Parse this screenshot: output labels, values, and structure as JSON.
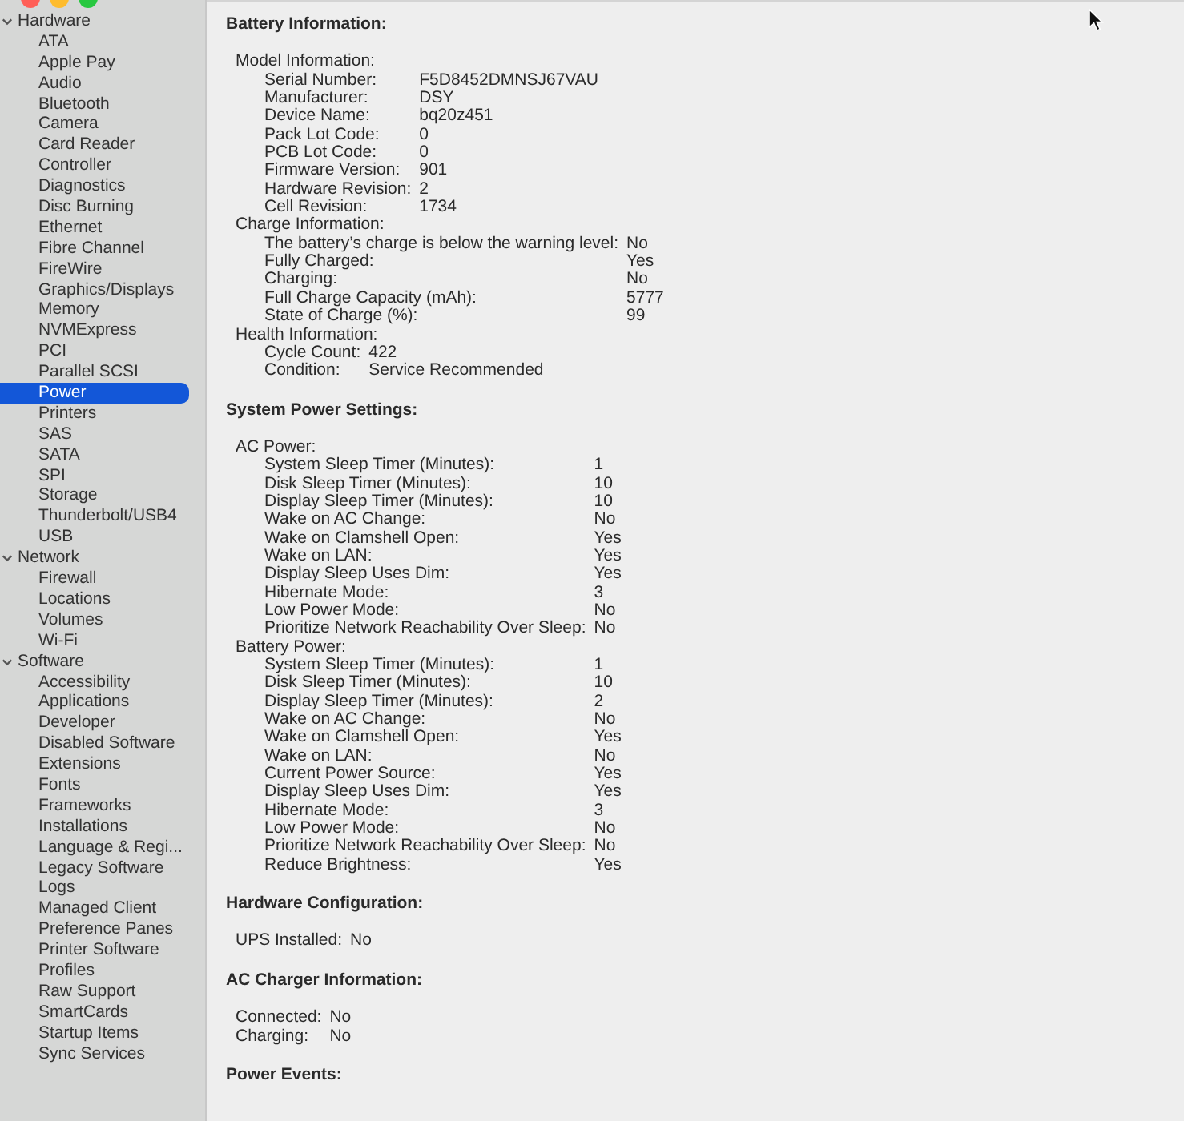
{
  "sidebar": {
    "groups": [
      {
        "label": "Hardware",
        "expanded": true,
        "items": [
          {
            "label": "ATA",
            "selected": false
          },
          {
            "label": "Apple Pay",
            "selected": false
          },
          {
            "label": "Audio",
            "selected": false
          },
          {
            "label": "Bluetooth",
            "selected": false
          },
          {
            "label": "Camera",
            "selected": false
          },
          {
            "label": "Card Reader",
            "selected": false
          },
          {
            "label": "Controller",
            "selected": false
          },
          {
            "label": "Diagnostics",
            "selected": false
          },
          {
            "label": "Disc Burning",
            "selected": false
          },
          {
            "label": "Ethernet",
            "selected": false
          },
          {
            "label": "Fibre Channel",
            "selected": false
          },
          {
            "label": "FireWire",
            "selected": false
          },
          {
            "label": "Graphics/Displays",
            "selected": false
          },
          {
            "label": "Memory",
            "selected": false
          },
          {
            "label": "NVMExpress",
            "selected": false
          },
          {
            "label": "PCI",
            "selected": false
          },
          {
            "label": "Parallel SCSI",
            "selected": false
          },
          {
            "label": "Power",
            "selected": true
          },
          {
            "label": "Printers",
            "selected": false
          },
          {
            "label": "SAS",
            "selected": false
          },
          {
            "label": "SATA",
            "selected": false
          },
          {
            "label": "SPI",
            "selected": false
          },
          {
            "label": "Storage",
            "selected": false
          },
          {
            "label": "Thunderbolt/USB4",
            "selected": false
          },
          {
            "label": "USB",
            "selected": false
          }
        ]
      },
      {
        "label": "Network",
        "expanded": true,
        "items": [
          {
            "label": "Firewall",
            "selected": false
          },
          {
            "label": "Locations",
            "selected": false
          },
          {
            "label": "Volumes",
            "selected": false
          },
          {
            "label": "Wi-Fi",
            "selected": false
          }
        ]
      },
      {
        "label": "Software",
        "expanded": true,
        "items": [
          {
            "label": "Accessibility",
            "selected": false
          },
          {
            "label": "Applications",
            "selected": false
          },
          {
            "label": "Developer",
            "selected": false
          },
          {
            "label": "Disabled Software",
            "selected": false
          },
          {
            "label": "Extensions",
            "selected": false
          },
          {
            "label": "Fonts",
            "selected": false
          },
          {
            "label": "Frameworks",
            "selected": false
          },
          {
            "label": "Installations",
            "selected": false
          },
          {
            "label": "Language & Regi...",
            "selected": false
          },
          {
            "label": "Legacy Software",
            "selected": false
          },
          {
            "label": "Logs",
            "selected": false
          },
          {
            "label": "Managed Client",
            "selected": false
          },
          {
            "label": "Preference Panes",
            "selected": false
          },
          {
            "label": "Printer Software",
            "selected": false
          },
          {
            "label": "Profiles",
            "selected": false
          },
          {
            "label": "Raw Support",
            "selected": false
          },
          {
            "label": "SmartCards",
            "selected": false
          },
          {
            "label": "Startup Items",
            "selected": false
          },
          {
            "label": "Sync Services",
            "selected": false
          }
        ]
      }
    ]
  },
  "sections": [
    {
      "title": "Battery Information:",
      "groups": [
        {
          "label": "Model Information:",
          "rows": [
            {
              "label": "Serial Number:",
              "value": "F5D8452DMNSJ67VAU"
            },
            {
              "label": "Manufacturer:",
              "value": "DSY"
            },
            {
              "label": "Device Name:",
              "value": "bq20z451"
            },
            {
              "label": "Pack Lot Code:",
              "value": "0"
            },
            {
              "label": "PCB Lot Code:",
              "value": "0"
            },
            {
              "label": "Firmware Version:",
              "value": "901"
            },
            {
              "label": "Hardware Revision:",
              "value": "2"
            },
            {
              "label": "Cell Revision:",
              "value": "1734"
            }
          ]
        },
        {
          "label": "Charge Information:",
          "rows": [
            {
              "label": "The battery’s charge is below the warning level:",
              "value": "No"
            },
            {
              "label": "Fully Charged:",
              "value": "Yes"
            },
            {
              "label": "Charging:",
              "value": "No"
            },
            {
              "label": "Full Charge Capacity (mAh):",
              "value": "5777"
            },
            {
              "label": "State of Charge (%):",
              "value": "99"
            }
          ]
        },
        {
          "label": "Health Information:",
          "rows": [
            {
              "label": "Cycle Count:",
              "value": "422"
            },
            {
              "label": "Condition:",
              "value": "Service Recommended"
            }
          ]
        }
      ]
    },
    {
      "title": "System Power Settings:",
      "groups": [
        {
          "label": "AC Power:",
          "rows": [
            {
              "label": "System Sleep Timer (Minutes):",
              "value": "1"
            },
            {
              "label": "Disk Sleep Timer (Minutes):",
              "value": "10"
            },
            {
              "label": "Display Sleep Timer (Minutes):",
              "value": "10"
            },
            {
              "label": "Wake on AC Change:",
              "value": "No"
            },
            {
              "label": "Wake on Clamshell Open:",
              "value": "Yes"
            },
            {
              "label": "Wake on LAN:",
              "value": "Yes"
            },
            {
              "label": "Display Sleep Uses Dim:",
              "value": "Yes"
            },
            {
              "label": "Hibernate Mode:",
              "value": "3"
            },
            {
              "label": "Low Power Mode:",
              "value": "No"
            },
            {
              "label": "Prioritize Network Reachability Over Sleep:",
              "value": "No"
            }
          ]
        },
        {
          "label": "Battery Power:",
          "rows": [
            {
              "label": "System Sleep Timer (Minutes):",
              "value": "1"
            },
            {
              "label": "Disk Sleep Timer (Minutes):",
              "value": "10"
            },
            {
              "label": "Display Sleep Timer (Minutes):",
              "value": "2"
            },
            {
              "label": "Wake on AC Change:",
              "value": "No"
            },
            {
              "label": "Wake on Clamshell Open:",
              "value": "Yes"
            },
            {
              "label": "Wake on LAN:",
              "value": "No"
            },
            {
              "label": "Current Power Source:",
              "value": "Yes"
            },
            {
              "label": "Display Sleep Uses Dim:",
              "value": "Yes"
            },
            {
              "label": "Hibernate Mode:",
              "value": "3"
            },
            {
              "label": "Low Power Mode:",
              "value": "No"
            },
            {
              "label": "Prioritize Network Reachability Over Sleep:",
              "value": "No"
            },
            {
              "label": "Reduce Brightness:",
              "value": "Yes"
            }
          ]
        }
      ]
    },
    {
      "title": "Hardware Configuration:",
      "groups": [
        {
          "rows": [
            {
              "label": "UPS Installed:",
              "value": "No"
            }
          ]
        }
      ]
    },
    {
      "title": "AC Charger Information:",
      "groups": [
        {
          "rows": [
            {
              "label": "Connected:",
              "value": "No"
            },
            {
              "label": "Charging:",
              "value": "No"
            }
          ]
        }
      ]
    },
    {
      "title": "Power Events:"
    }
  ]
}
